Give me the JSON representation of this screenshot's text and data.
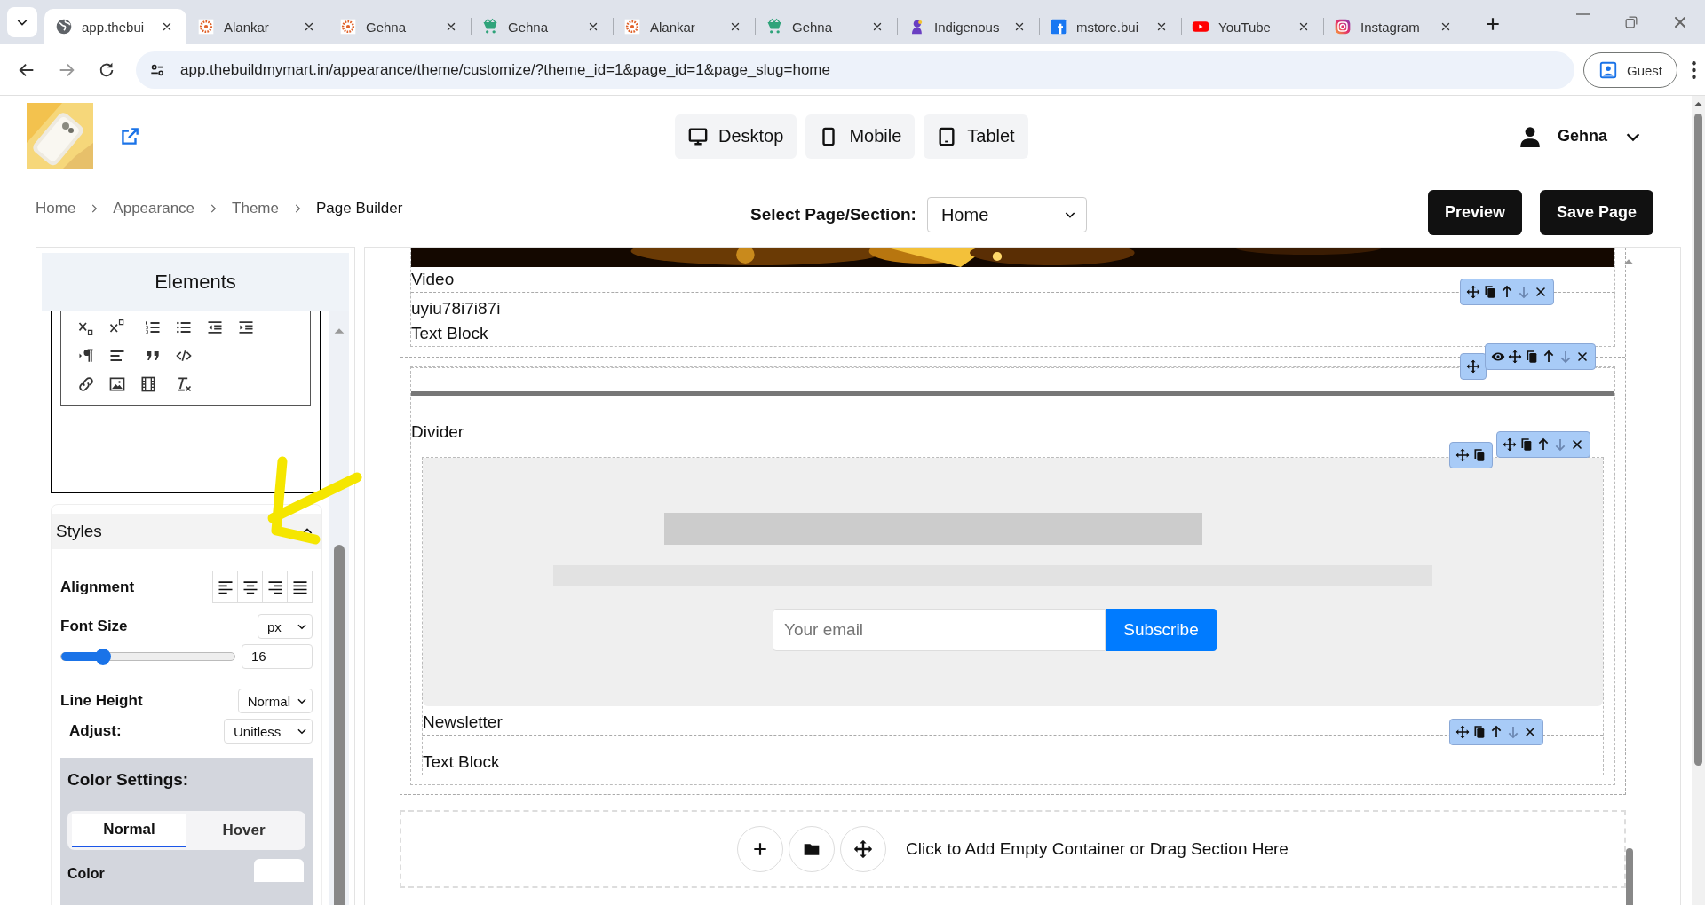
{
  "browser": {
    "tabs": [
      {
        "title": "app.thebui",
        "selected": true
      },
      {
        "title": "Alankar",
        "selected": false
      },
      {
        "title": "Gehna",
        "selected": false
      },
      {
        "title": "Gehna",
        "selected": false
      },
      {
        "title": "Alankar",
        "selected": false
      },
      {
        "title": "Gehna",
        "selected": false
      },
      {
        "title": "Indigenous",
        "selected": false
      },
      {
        "title": "mstore.bui",
        "selected": false
      },
      {
        "title": "YouTube",
        "selected": false
      },
      {
        "title": "Instagram",
        "selected": false
      }
    ],
    "url": "app.thebuildmymart.in/appearance/theme/customize/?theme_id=1&page_id=1&page_slug=home",
    "profile": "Guest"
  },
  "header": {
    "user": "Gehna",
    "devices": [
      {
        "label": "Desktop"
      },
      {
        "label": "Mobile"
      },
      {
        "label": "Tablet"
      }
    ]
  },
  "breadcrumb": [
    "Home",
    "Appearance",
    "Theme",
    "Page Builder"
  ],
  "page_select": {
    "label": "Select Page/Section:",
    "value": "Home"
  },
  "actions": [
    "Preview",
    "Save Page"
  ],
  "sidebar": {
    "title": "Elements",
    "styles": {
      "title": "Styles",
      "expanded": true,
      "alignment_label": "Alignment",
      "font_size": {
        "label": "Font Size",
        "unit": "px",
        "level": 0.24,
        "value": "16"
      },
      "line_height": {
        "label": "Line Height",
        "value": "Normal"
      },
      "adjust": {
        "label": "Adjust:",
        "value": "Unitless"
      },
      "color_settings": {
        "title": "Color Settings:",
        "tabs": [
          {
            "label": "Normal",
            "selected": true
          },
          {
            "label": "Hover",
            "selected": false
          }
        ],
        "color_label": "Color"
      }
    }
  },
  "canvas": {
    "video": {
      "label": "Video"
    },
    "text_block": {
      "text": "uyiu78i7i87i",
      "label": "Text Block"
    },
    "divider": {
      "label": "Divider"
    },
    "newsletter": {
      "placeholder": "Your email",
      "button": "Subscribe",
      "label": "Newsletter"
    },
    "text_block_2": {
      "label": "Text Block"
    },
    "add_section": {
      "text": "Click to Add Empty Container or Drag Section Here"
    }
  }
}
